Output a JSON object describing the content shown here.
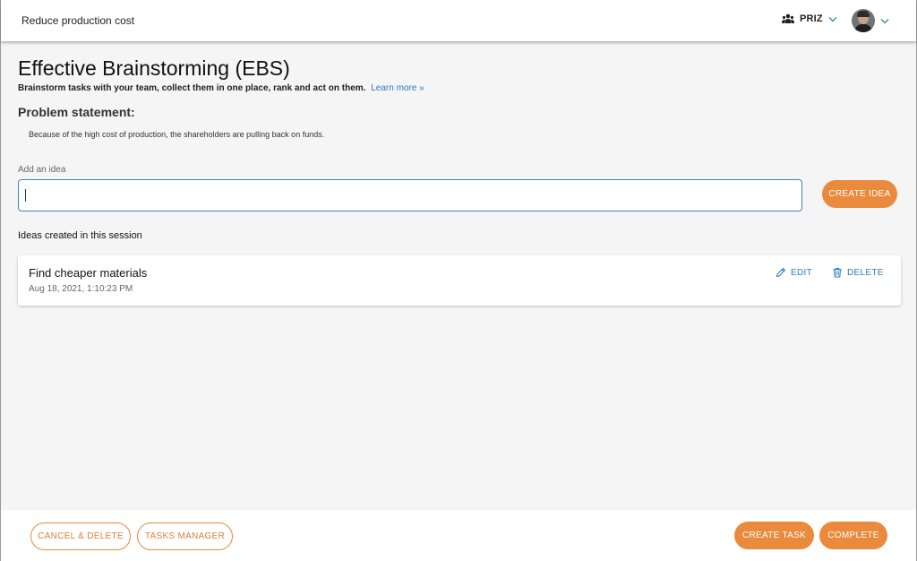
{
  "header": {
    "title": "Reduce production cost",
    "team_label": "PRIZ"
  },
  "page": {
    "title": "Effective Brainstorming (EBS)",
    "subtitle": "Brainstorm tasks with your team, collect them in one place, rank and act on them.",
    "learn_more": "Learn more »",
    "problem_heading": "Problem statement:",
    "problem_text": "Because of the high cost of production, the shareholders are pulling back on funds."
  },
  "idea_form": {
    "label": "Add an idea",
    "value": "",
    "create_button": "CREATE IDEA"
  },
  "ideas": {
    "heading": "Ideas created in this session",
    "items": [
      {
        "title": "Find cheaper materials",
        "timestamp": "Aug 18, 2021, 1:10:23 PM",
        "edit_label": "EDIT",
        "delete_label": "DELETE"
      }
    ]
  },
  "footer": {
    "cancel_delete": "CANCEL & DELETE",
    "tasks_manager": "TASKS MANAGER",
    "create_task": "CREATE TASK",
    "complete": "COMPLETE"
  },
  "colors": {
    "accent": "#ea8a3c",
    "link": "#2a7bbf",
    "input_border": "#3a86bf",
    "background": "#f5f5f5"
  },
  "icons": {
    "team": "people-group-icon",
    "edit": "pencil-icon",
    "delete": "trash-icon",
    "dropdown": "chevron-down-icon"
  }
}
